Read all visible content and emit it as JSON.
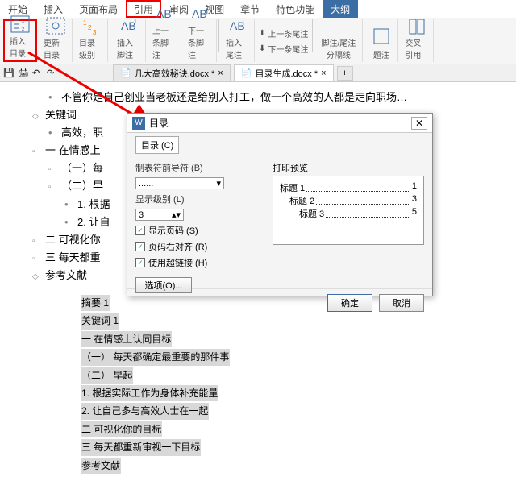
{
  "menu": {
    "items": [
      "开始",
      "插入",
      "页面布局",
      "引用",
      "审阅",
      "视图",
      "章节",
      "特色功能",
      "大纲"
    ],
    "highlighted_index": 3,
    "active_index": 8
  },
  "ribbon": {
    "insert_toc": "插入目录",
    "update_toc": "更新目录",
    "toc_level": "目录级别",
    "insert_footnote": "插入脚注",
    "prev_footnote": "上一条脚注",
    "next_footnote": "下一条脚注",
    "insert_endnote": "插入尾注",
    "prev_endnote": "上一条尾注",
    "next_endnote": "下一条尾注",
    "sep_line": "脚注/尾注分隔线",
    "caption": "题注",
    "cross_ref": "交叉引用"
  },
  "tabs": {
    "t1": "几大高效秘诀.docx *",
    "t2": "目录生成.docx *"
  },
  "doc": {
    "line1": "不管你是自己创业当老板还是给别人打工，做一个高效的人都是走向职场…",
    "kw": "关键词",
    "kw1": "高效，职",
    "h1": "一  在情感上",
    "h1a": "（一）每",
    "h1b": "（二）早",
    "h1b1": "1. 根据",
    "h1b2": "2. 让自",
    "h2": "二  可视化你",
    "h3": "三  每天都重",
    "refs": "参考文献",
    "grey": [
      "摘要    1",
      "关键词  1",
      "一  在情感上认同目标",
      "（一）  每天都确定最重要的那件事",
      "（二）  早起",
      "1. 根据实际工作为身体补充能量",
      "2. 让自己多与高效人士在一起",
      "二  可视化你的目标",
      "三  每天都重新审视一下目标",
      "参考文献"
    ]
  },
  "dialog": {
    "title": "目录",
    "tab": "目录 (C)",
    "leader_label": "制表符前导符 (B)",
    "leader_value": "......",
    "level_label": "显示级别 (L)",
    "level_value": "3",
    "chk1": "显示页码 (S)",
    "chk2": "页码右对齐 (R)",
    "chk3": "使用超链接 (H)",
    "options": "选项(O)...",
    "preview_label": "打印预览",
    "preview": [
      {
        "t": "标题 1",
        "p": "1"
      },
      {
        "t": "标题 2",
        "p": "3"
      },
      {
        "t": "标题 3",
        "p": "5"
      }
    ],
    "ok": "确定",
    "cancel": "取消"
  }
}
